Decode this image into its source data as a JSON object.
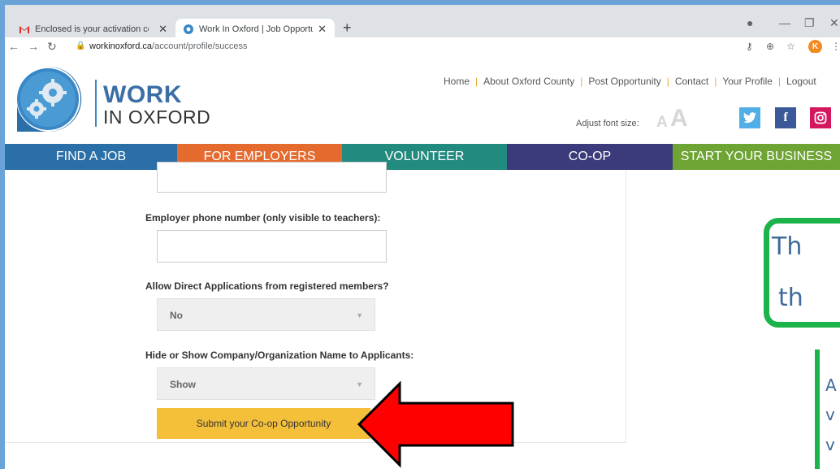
{
  "browser": {
    "tabs": [
      {
        "title": "Enclosed is your activation code"
      },
      {
        "title": "Work In Oxford | Job Opportuniti"
      }
    ],
    "url_host": "workinoxford.ca",
    "url_path": "/account/profile/success",
    "avatar_letter": "K",
    "new_tab": "+"
  },
  "site": {
    "logo_work": "WORK",
    "logo_oxford": "IN OXFORD",
    "top_links": [
      "Home",
      "About Oxford County",
      "Post Opportunity",
      "Contact",
      "Your Profile",
      "Logout"
    ],
    "font_size_label": "Adjust font size:",
    "font_small": "A",
    "font_large": "A"
  },
  "nav": [
    "FIND A JOB",
    "FOR EMPLOYERS",
    "VOLUNTEER",
    "CO-OP",
    "START YOUR BUSINESS"
  ],
  "form": {
    "phone_label": "Employer phone number (only visible to teachers):",
    "direct_apply_label": "Allow Direct Applications from registered members?",
    "direct_apply_value": "No",
    "hide_show_label": "Hide or Show Company/Organization Name to Applicants:",
    "hide_show_value": "Show",
    "submit_label": "Submit your Co-op Opportunity"
  },
  "annotation": {
    "callout_line1": "Th",
    "callout_line2": "th",
    "side_lines": [
      "A",
      "v",
      "v"
    ]
  },
  "colors": {
    "nav_find": "#2a6fa8",
    "nav_employers": "#e56a2e",
    "nav_volunteer": "#238a7f",
    "nav_coop": "#3b3a7a",
    "nav_business": "#6ea433",
    "submit": "#f4c03a",
    "arrow": "#ff0000",
    "callout_border": "#1bb34a"
  }
}
